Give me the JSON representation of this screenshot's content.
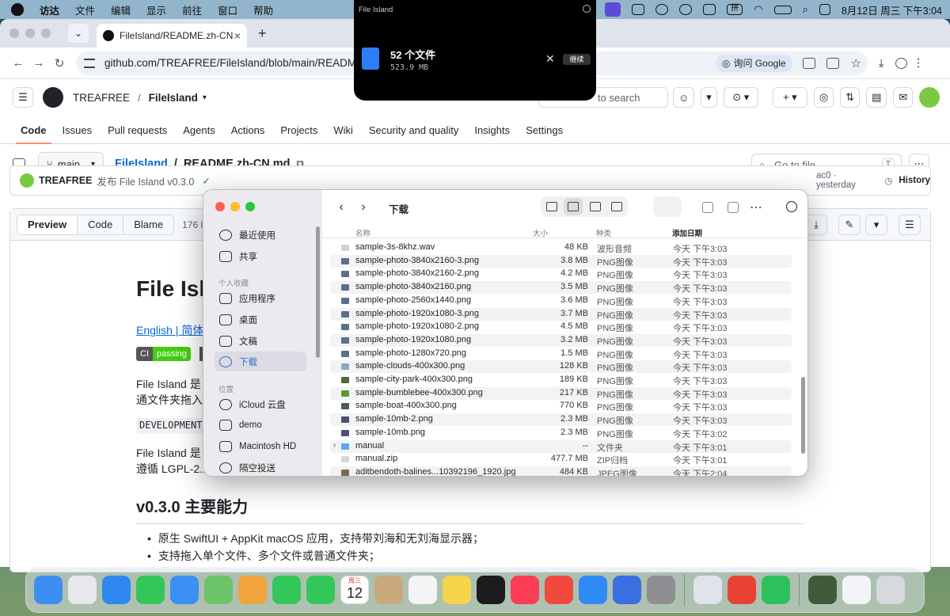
{
  "menubar": {
    "app": "访达",
    "items": [
      "文件",
      "编辑",
      "显示",
      "前往",
      "窗口",
      "帮助"
    ],
    "ime": "拼",
    "datetime": "8月12日 周三 下午3:04"
  },
  "browser": {
    "tab_title": "FileIsland/README.zh-CN.md",
    "url": "github.com/TREAFREE/FileIsland/blob/main/README.zh-C",
    "google_lens": "询问 Google"
  },
  "github": {
    "owner": "TREAFREE",
    "repo": "FileIsland",
    "search_placeholder": "to search",
    "nav_tabs": [
      "Code",
      "Issues",
      "Pull requests",
      "Agents",
      "Actions",
      "Projects",
      "Wiki",
      "Security and quality",
      "Insights",
      "Settings"
    ],
    "branch": "main",
    "breadcrumb_repo": "FileIsland",
    "breadcrumb_file": "README.zh-CN.md",
    "goto_file": "Go to file",
    "goto_key": "T",
    "commit_author": "TREAFREE",
    "commit_message": "发布 File Island v0.3.0",
    "commit_meta": "ac0 · yesterday",
    "history": "History",
    "view_tabs": [
      "Preview",
      "Code",
      "Blame"
    ],
    "lines": "176 lines"
  },
  "readme": {
    "h1": "File Isla",
    "lang_links": "English | 简体",
    "badge_ci": "CI",
    "badge_status": "passing",
    "p1_line1": "File Island 是",
    "p1_line2": "通文件夹拖入",
    "code_snippet": "DEVELOPMENT_",
    "p2_line1": "File Island 是",
    "p2_line2": "遵循 LGPL-2.1",
    "h2": "v0.3.0 主要能力",
    "bullets": [
      "原生 SwiftUI + AppKit macOS 应用，支持带刘海和无刘海显示器；",
      "支持拖入单个文件、多个文件或普通文件夹；"
    ]
  },
  "notification": {
    "app": "File Island",
    "title": "52 个文件",
    "size": "523.9 MB",
    "action": "继续"
  },
  "finder": {
    "title": "下载",
    "sidebar_favorites_header": "个人收藏",
    "sidebar_locations_header": "位置",
    "sidebar": [
      "最近使用",
      "共享",
      "应用程序",
      "桌面",
      "文稿",
      "下载",
      "iCloud 云盘",
      "demo",
      "Macintosh HD",
      "隔空投送"
    ],
    "columns": [
      "名称",
      "大小",
      "种类",
      "添加日期"
    ],
    "files": [
      {
        "name": "sample-3s-8khz.wav",
        "size": "48 KB",
        "kind": "波形音频",
        "date": "今天 下午3:03",
        "color": "#cfd3d8"
      },
      {
        "name": "sample-photo-3840x2160-3.png",
        "size": "3.8 MB",
        "kind": "PNG图像",
        "date": "今天 下午3:03",
        "color": "#5a6f8c"
      },
      {
        "name": "sample-photo-3840x2160-2.png",
        "size": "4.2 MB",
        "kind": "PNG图像",
        "date": "今天 下午3:03",
        "color": "#5a6f8c"
      },
      {
        "name": "sample-photo-3840x2160.png",
        "size": "3.5 MB",
        "kind": "PNG图像",
        "date": "今天 下午3:03",
        "color": "#5a6f8c"
      },
      {
        "name": "sample-photo-2560x1440.png",
        "size": "3.6 MB",
        "kind": "PNG图像",
        "date": "今天 下午3:03",
        "color": "#5a6f8c"
      },
      {
        "name": "sample-photo-1920x1080-3.png",
        "size": "3.7 MB",
        "kind": "PNG图像",
        "date": "今天 下午3:03",
        "color": "#5a6f8c"
      },
      {
        "name": "sample-photo-1920x1080-2.png",
        "size": "4.5 MB",
        "kind": "PNG图像",
        "date": "今天 下午3:03",
        "color": "#5a6f8c"
      },
      {
        "name": "sample-photo-1920x1080.png",
        "size": "3.2 MB",
        "kind": "PNG图像",
        "date": "今天 下午3:03",
        "color": "#5a6f8c"
      },
      {
        "name": "sample-photo-1280x720.png",
        "size": "1.5 MB",
        "kind": "PNG图像",
        "date": "今天 下午3:03",
        "color": "#5a6f8c"
      },
      {
        "name": "sample-clouds-400x300.png",
        "size": "128 KB",
        "kind": "PNG图像",
        "date": "今天 下午3:03",
        "color": "#8fa6c2"
      },
      {
        "name": "sample-city-park-400x300.png",
        "size": "189 KB",
        "kind": "PNG图像",
        "date": "今天 下午3:03",
        "color": "#4d6a3c"
      },
      {
        "name": "sample-bumblebee-400x300.png",
        "size": "217 KB",
        "kind": "PNG图像",
        "date": "今天 下午3:03",
        "color": "#5b9a3a"
      },
      {
        "name": "sample-boat-400x300.png",
        "size": "770 KB",
        "kind": "PNG图像",
        "date": "今天 下午3:03",
        "color": "#4a5f52"
      },
      {
        "name": "sample-10mb-2.png",
        "size": "2.3 MB",
        "kind": "PNG图像",
        "date": "今天 下午3:03",
        "color": "#4c4f7a"
      },
      {
        "name": "sample-10mb.png",
        "size": "2.3 MB",
        "kind": "PNG图像",
        "date": "今天 下午3:02",
        "color": "#4c4f7a"
      },
      {
        "name": "manual",
        "size": "--",
        "kind": "文件夹",
        "date": "今天 下午3:01",
        "color": "#5aa9e8"
      },
      {
        "name": "manual.zip",
        "size": "477.7 MB",
        "kind": "ZIP归档",
        "date": "今天 下午3:01",
        "color": "#d5d7db"
      },
      {
        "name": "aditbendoth-balines...10392196_1920.jpg",
        "size": "484 KB",
        "kind": "JPEG图像",
        "date": "今天 下午2:04",
        "color": "#7b6a4a"
      }
    ]
  },
  "dock": {
    "calendar_month": "周三",
    "calendar_day": "12",
    "apps": [
      {
        "name": "finder-icon",
        "color": "#3d8ef0"
      },
      {
        "name": "launchpad-icon",
        "color": "#e8e8ec"
      },
      {
        "name": "safari-icon",
        "color": "#2f88f0"
      },
      {
        "name": "messages-icon",
        "color": "#33c759"
      },
      {
        "name": "mail-icon",
        "color": "#3b8ff5"
      },
      {
        "name": "maps-icon",
        "color": "#6bc36a"
      },
      {
        "name": "photos-icon",
        "color": "#f3a33b"
      },
      {
        "name": "facetime-icon",
        "color": "#33c759"
      },
      {
        "name": "phone-icon",
        "color": "#33c759"
      },
      {
        "name": "calendar-icon",
        "color": "#ffffff"
      },
      {
        "name": "contacts-icon",
        "color": "#c9a97c"
      },
      {
        "name": "reminders-icon",
        "color": "#f4f4f6"
      },
      {
        "name": "notes-icon",
        "color": "#f7d54a"
      },
      {
        "name": "tv-icon",
        "color": "#1c1c1e"
      },
      {
        "name": "music-icon",
        "color": "#fa3c55"
      },
      {
        "name": "rocket-icon",
        "color": "#f04a3c"
      },
      {
        "name": "appstore-icon",
        "color": "#2f8af5"
      },
      {
        "name": "simulator-icon",
        "color": "#3a6fe0"
      },
      {
        "name": "settings-icon",
        "color": "#8e8e93"
      },
      {
        "name": "rocket-launcher-icon",
        "color": "#dfe3ea"
      },
      {
        "name": "chrome-icon",
        "color": "#e94235"
      },
      {
        "name": "wechat-icon",
        "color": "#2ec05a"
      },
      {
        "name": "thumbnail-icon",
        "color": "#3f5b3a"
      },
      {
        "name": "window-thumbnail-icon",
        "color": "#f2f4f7"
      },
      {
        "name": "trash-icon",
        "color": "#d6d9de"
      }
    ]
  }
}
